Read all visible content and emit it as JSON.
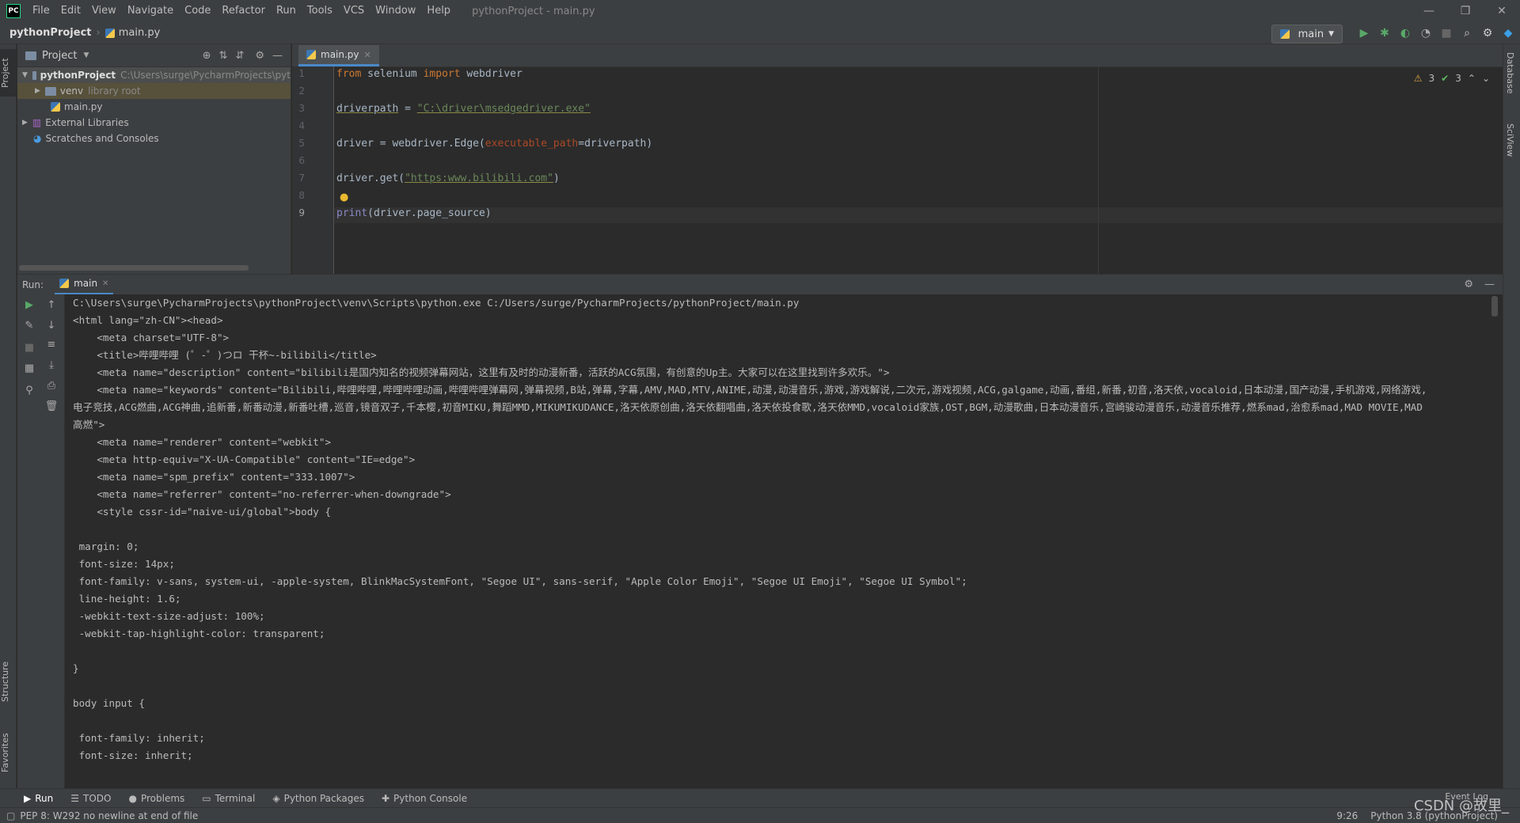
{
  "app": {
    "logo": "PC",
    "window_title": "pythonProject - main.py",
    "menu": [
      "File",
      "Edit",
      "View",
      "Navigate",
      "Code",
      "Refactor",
      "Run",
      "Tools",
      "VCS",
      "Window",
      "Help"
    ]
  },
  "window_controls": {
    "minimize": "—",
    "restore": "❐",
    "close": "✕"
  },
  "navbar": {
    "project": "pythonProject",
    "file": "main.py",
    "run_config": "main"
  },
  "left_stripe": {
    "project_tab": "Project",
    "structure_tab": "Structure",
    "favorites_tab": "Favorites"
  },
  "right_stripe": {
    "database_tab": "Database",
    "sciview_tab": "SciView"
  },
  "project_panel": {
    "title": "Project",
    "tree": [
      {
        "label": "pythonProject",
        "path": "C:\\Users\\surge\\PycharmProjects\\pyt"
      },
      {
        "label": "venv",
        "path": "library root"
      },
      {
        "label": "main.py",
        "path": ""
      },
      {
        "label": "External Libraries",
        "path": ""
      },
      {
        "label": "Scratches and Consoles",
        "path": ""
      }
    ]
  },
  "editor": {
    "tab": "main.py",
    "inspections": {
      "warnings": "3",
      "weak_warnings": "3"
    },
    "line_numbers": [
      "1",
      "2",
      "3",
      "4",
      "5",
      "6",
      "7",
      "8",
      "9"
    ],
    "code": {
      "l1_from": "from",
      "l1_mod": " selenium ",
      "l1_import": "import",
      "l1_name": " webdriver",
      "l3_var": "driverpath",
      "l3_eq": " = ",
      "l3_str": "\"C:\\driver\\msedgedriver.exe\"",
      "l5_a": "driver = webdriver.Edge(",
      "l5_param": "executable_path",
      "l5_b": "=driverpath)",
      "l7_a": "driver.get(",
      "l7_str": "\"https:www.bilibili.com\"",
      "l7_b": ")",
      "l9_print": "print",
      "l9_rest": "(driver.page_source)"
    }
  },
  "run_panel": {
    "label": "Run:",
    "tab": "main",
    "console": [
      "C:\\Users\\surge\\PycharmProjects\\pythonProject\\venv\\Scripts\\python.exe C:/Users/surge/PycharmProjects/pythonProject/main.py",
      "<html lang=\"zh-CN\"><head>",
      "    <meta charset=\"UTF-8\">",
      "    <title>哔哩哔哩 (゜-゜)つロ 干杯~-bilibili</title>",
      "    <meta name=\"description\" content=\"bilibili是国内知名的视频弹幕网站，这里有及时的动漫新番，活跃的ACG氛围，有创意的Up主。大家可以在这里找到许多欢乐。\">",
      "    <meta name=\"keywords\" content=\"Bilibili,哔哩哔哩,哔哩哔哩动画,哔哩哔哩弹幕网,弹幕视频,B站,弹幕,字幕,AMV,MAD,MTV,ANIME,动漫,动漫音乐,游戏,游戏解说,二次元,游戏视频,ACG,galgame,动画,番组,新番,初音,洛天依,vocaloid,日本动漫,国产动漫,手机游戏,网络游戏,",
      "电子竞技,ACG燃曲,ACG神曲,追新番,新番动漫,新番吐槽,巡音,镜音双子,千本樱,初音MIKU,舞蹈MMD,MIKUMIKUDANCE,洛天依原创曲,洛天依翻唱曲,洛天依投食歌,洛天依MMD,vocaloid家族,OST,BGM,动漫歌曲,日本动漫音乐,宫崎骏动漫音乐,动漫音乐推荐,燃系mad,治愈系mad,MAD MOVIE,MAD",
      "高燃\">",
      "    <meta name=\"renderer\" content=\"webkit\">",
      "    <meta http-equiv=\"X-UA-Compatible\" content=\"IE=edge\">",
      "    <meta name=\"spm_prefix\" content=\"333.1007\">",
      "    <meta name=\"referrer\" content=\"no-referrer-when-downgrade\">",
      "    <style cssr-id=\"naive-ui/global\">body {",
      "",
      " margin: 0;",
      " font-size: 14px;",
      " font-family: v-sans, system-ui, -apple-system, BlinkMacSystemFont, \"Segoe UI\", sans-serif, \"Apple Color Emoji\", \"Segoe UI Emoji\", \"Segoe UI Symbol\";",
      " line-height: 1.6;",
      " -webkit-text-size-adjust: 100%;",
      " -webkit-tap-highlight-color: transparent;",
      "",
      "}",
      "",
      "body input {",
      "",
      " font-family: inherit;",
      " font-size: inherit;"
    ]
  },
  "bottom_tabs": [
    "Run",
    "TODO",
    "Problems",
    "Terminal",
    "Python Packages",
    "Python Console"
  ],
  "event_log": "Event Log",
  "status": {
    "message": "PEP 8: W292 no newline at end of file",
    "position": "9:26",
    "interpreter": "Python 3.8 (pythonProject)"
  },
  "watermark": "CSDN @故里_"
}
